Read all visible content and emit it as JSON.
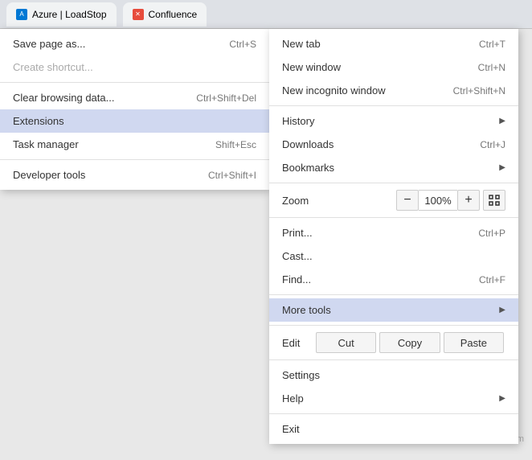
{
  "browser": {
    "tabs": [
      {
        "label": "Azure | LoadStop",
        "faviconColor": "#0078d4",
        "faviconText": "A"
      },
      {
        "label": "Confluence",
        "faviconColor": "#e74c3c",
        "faviconText": "X"
      }
    ]
  },
  "primaryMenu": {
    "items": [
      {
        "id": "save-page-as",
        "label": "Save page as...",
        "shortcut": "Ctrl+S",
        "disabled": false,
        "hasSubmenu": false
      },
      {
        "id": "create-shortcut",
        "label": "Create shortcut...",
        "shortcut": "",
        "disabled": true,
        "hasSubmenu": false
      },
      {
        "id": "divider1",
        "type": "divider"
      },
      {
        "id": "clear-browsing-data",
        "label": "Clear browsing data...",
        "shortcut": "Ctrl+Shift+Del",
        "disabled": false,
        "hasSubmenu": false
      },
      {
        "id": "extensions",
        "label": "Extensions",
        "shortcut": "",
        "disabled": false,
        "hasSubmenu": false,
        "highlighted": true
      },
      {
        "id": "task-manager",
        "label": "Task manager",
        "shortcut": "Shift+Esc",
        "disabled": false,
        "hasSubmenu": false
      },
      {
        "id": "divider2",
        "type": "divider"
      },
      {
        "id": "developer-tools",
        "label": "Developer tools",
        "shortcut": "Ctrl+Shift+I",
        "disabled": false,
        "hasSubmenu": false
      }
    ]
  },
  "secondaryMenu": {
    "items": [
      {
        "id": "new-tab",
        "label": "New tab",
        "shortcut": "Ctrl+T",
        "hasSubmenu": false
      },
      {
        "id": "new-window",
        "label": "New window",
        "shortcut": "Ctrl+N",
        "hasSubmenu": false
      },
      {
        "id": "new-incognito",
        "label": "New incognito window",
        "shortcut": "Ctrl+Shift+N",
        "hasSubmenu": false
      },
      {
        "id": "divider1",
        "type": "divider"
      },
      {
        "id": "history",
        "label": "History",
        "shortcut": "",
        "hasSubmenu": true
      },
      {
        "id": "downloads",
        "label": "Downloads",
        "shortcut": "Ctrl+J",
        "hasSubmenu": false
      },
      {
        "id": "bookmarks",
        "label": "Bookmarks",
        "shortcut": "",
        "hasSubmenu": true
      },
      {
        "id": "divider2",
        "type": "divider"
      },
      {
        "id": "zoom",
        "type": "zoom",
        "label": "Zoom",
        "minus": "−",
        "value": "100%",
        "plus": "+"
      },
      {
        "id": "divider3",
        "type": "divider"
      },
      {
        "id": "print",
        "label": "Print...",
        "shortcut": "Ctrl+P",
        "hasSubmenu": false
      },
      {
        "id": "cast",
        "label": "Cast...",
        "shortcut": "",
        "hasSubmenu": false
      },
      {
        "id": "find",
        "label": "Find...",
        "shortcut": "Ctrl+F",
        "hasSubmenu": false
      },
      {
        "id": "divider4",
        "type": "divider"
      },
      {
        "id": "more-tools",
        "label": "More tools",
        "shortcut": "",
        "hasSubmenu": true,
        "highlighted": true
      },
      {
        "id": "divider5",
        "type": "divider"
      },
      {
        "id": "edit-row",
        "type": "edit",
        "label": "Edit",
        "cut": "Cut",
        "copy": "Copy",
        "paste": "Paste"
      },
      {
        "id": "divider6",
        "type": "divider"
      },
      {
        "id": "settings",
        "label": "Settings",
        "shortcut": "",
        "hasSubmenu": false
      },
      {
        "id": "help",
        "label": "Help",
        "shortcut": "",
        "hasSubmenu": true
      },
      {
        "id": "divider7",
        "type": "divider"
      },
      {
        "id": "exit",
        "label": "Exit",
        "shortcut": "",
        "hasSubmenu": false
      }
    ]
  },
  "watermark": "wsxdn.com"
}
